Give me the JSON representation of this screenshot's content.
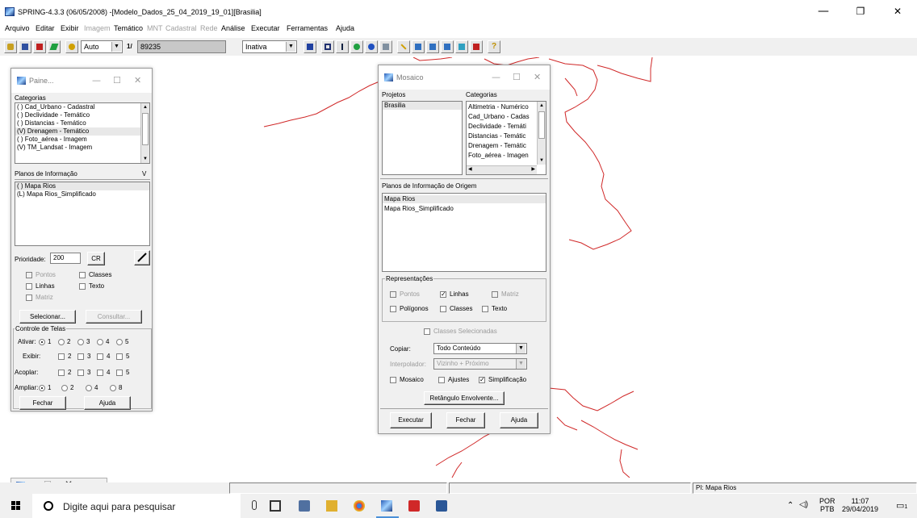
{
  "window": {
    "title": "SPRING-4.3.3 (06/05/2008) -[Modelo_Dados_25_04_2019_19_01][Brasilia]",
    "min": "—",
    "max": "❐",
    "close": "✕"
  },
  "menu": [
    {
      "label": "Arquivo",
      "enabled": true
    },
    {
      "label": "Editar",
      "enabled": true
    },
    {
      "label": "Exibir",
      "enabled": true
    },
    {
      "label": "Imagem",
      "enabled": false
    },
    {
      "label": "Temático",
      "enabled": true
    },
    {
      "label": "MNT",
      "enabled": false
    },
    {
      "label": "Cadastral",
      "enabled": false
    },
    {
      "label": "Rede",
      "enabled": false
    },
    {
      "label": "Análise",
      "enabled": true
    },
    {
      "label": "Executar",
      "enabled": true
    },
    {
      "label": "Ferramentas",
      "enabled": true
    },
    {
      "label": "Ajuda",
      "enabled": true
    }
  ],
  "toolbar": {
    "zoom_mode": "Auto",
    "scale_prefix": "1/",
    "scale_value": "89235",
    "state": "Inativa",
    "help_glyph": "?"
  },
  "painel": {
    "title": "Paine...",
    "categorias_label": "Categorias",
    "categorias": [
      "( ) Cad_Urbano - Cadastral",
      "( ) Declividade - Temático",
      "( ) Distancias - Temático",
      "(V) Drenagem - Temático",
      "( ) Foto_aérea - Imagem",
      "(V) TM_Landsat - Imagem"
    ],
    "planos_label": "Planos de Informação",
    "planos_toggle": "V",
    "planos": [
      "( ) Mapa Rios",
      "(L) Mapa Rios_Simplificado"
    ],
    "prioridade_label": "Prioridade:",
    "prioridade_value": "200",
    "cr_label": "CR",
    "pontos": "Pontos",
    "classes": "Classes",
    "linhas": "Linhas",
    "texto": "Texto",
    "matriz": "Matriz",
    "selecionar": "Selecionar...",
    "consultar": "Consultar...",
    "controle_label": "Controle de Telas",
    "ativar_label": "Ativar:",
    "exibir_label": "Exibir:",
    "acoplar_label": "Acoplar:",
    "ampliar_label": "Ampliar:",
    "telas": [
      "1",
      "2",
      "3",
      "4",
      "5"
    ],
    "ampliar_opts": [
      "1",
      "2",
      "4",
      "8"
    ],
    "fechar": "Fechar",
    "ajuda": "Ajuda"
  },
  "mosaico": {
    "title": "Mosaico",
    "projetos_label": "Projetos",
    "projetos": [
      "Brasilia"
    ],
    "categorias_label": "Categorias",
    "categorias": [
      "Altimetria - Numérico",
      "Cad_Urbano - Cadas",
      "Declividade - Temáti",
      "Distancias - Temátic",
      "Drenagem - Temátic",
      "Foto_aérea - Imagen"
    ],
    "planos_label": "Planos de Informação de Origem",
    "planos": [
      "Mapa Rios",
      "Mapa Rios_Simplificado"
    ],
    "repr_label": "Representações",
    "pontos": "Pontos",
    "linhas": "Linhas",
    "matriz": "Matriz",
    "poligonos": "Polígonos",
    "classes": "Classes",
    "texto": "Texto",
    "classes_sel": "Classes Selecionadas",
    "copiar_label": "Copiar:",
    "copiar_value": "Todo Conteúdo",
    "interp_label": "Interpolador:",
    "interp_value": "Vizinho + Próximo",
    "mosaico_cb": "Mosaico",
    "ajustes_cb": "Ajustes",
    "simpl_cb": "Simplificação",
    "retangulo": "Retângulo Envolvente...",
    "executar": "Executar",
    "fechar": "Fechar",
    "ajuda": "Ajuda"
  },
  "status": {
    "pi": "PI: Mapa Rios"
  },
  "taskbar": {
    "search_placeholder": "Digite aqui para pesquisar",
    "lang": "POR",
    "layout": "PTB",
    "time": "11:07",
    "date": "29/04/2019",
    "notif_count": "1"
  },
  "colors": {
    "river": "#d02828",
    "panel_bg": "#f0f0f0"
  }
}
